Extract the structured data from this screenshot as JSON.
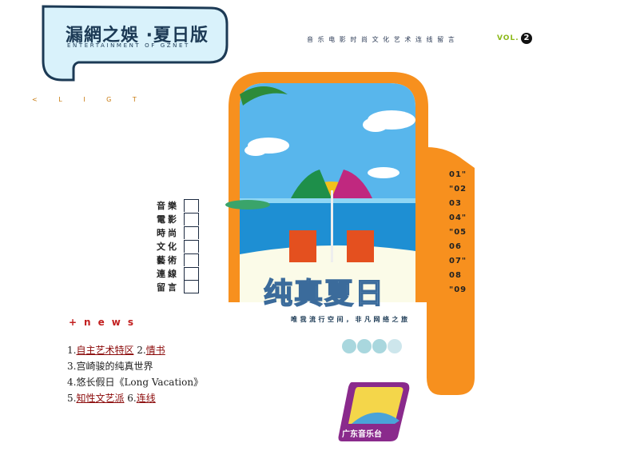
{
  "logo": {
    "title": "漏網之娛 ·夏日版",
    "subtitle": "ENTERTAINMENT OF GZNET"
  },
  "topnav": {
    "items": [
      "音",
      "乐",
      "电",
      "影",
      "时",
      "尚",
      "文",
      "化",
      "艺",
      "术",
      "连",
      "线",
      "留",
      "言"
    ],
    "vol_label": "VOL.",
    "vol_number": "2"
  },
  "light_label": "< L I G T",
  "side_menu": [
    "音樂",
    "電影",
    "時尚",
    "文化",
    "藝術",
    "連線",
    "留言"
  ],
  "numbers": [
    "01\"",
    "\"02",
    "03",
    "04\"",
    "\"05",
    "06",
    "07\"",
    "08",
    "\"09"
  ],
  "hero": {
    "title": "纯真夏日",
    "slogan": "唯我流行空间，非凡网络之旅"
  },
  "news": {
    "heading": "+news",
    "items": [
      {
        "num": "1.",
        "text": "自主艺术特区",
        "link": true
      },
      {
        "num": "2.",
        "text": "情书",
        "link": true
      },
      {
        "num": "3.",
        "text": "宫崎骏的纯真世界",
        "link": false
      },
      {
        "num": "4.",
        "text": "悠长假日《Long Vacation》",
        "link": false
      },
      {
        "num": "5.",
        "text": "知性文艺派",
        "link": true
      },
      {
        "num": "6.",
        "text": "连线",
        "link": true
      }
    ]
  },
  "radio_label": "广东音乐台",
  "colors": {
    "orange": "#f7901e",
    "navy": "#1c3a55",
    "sky": "#4fb1e8",
    "sea": "#2e9bd6"
  }
}
